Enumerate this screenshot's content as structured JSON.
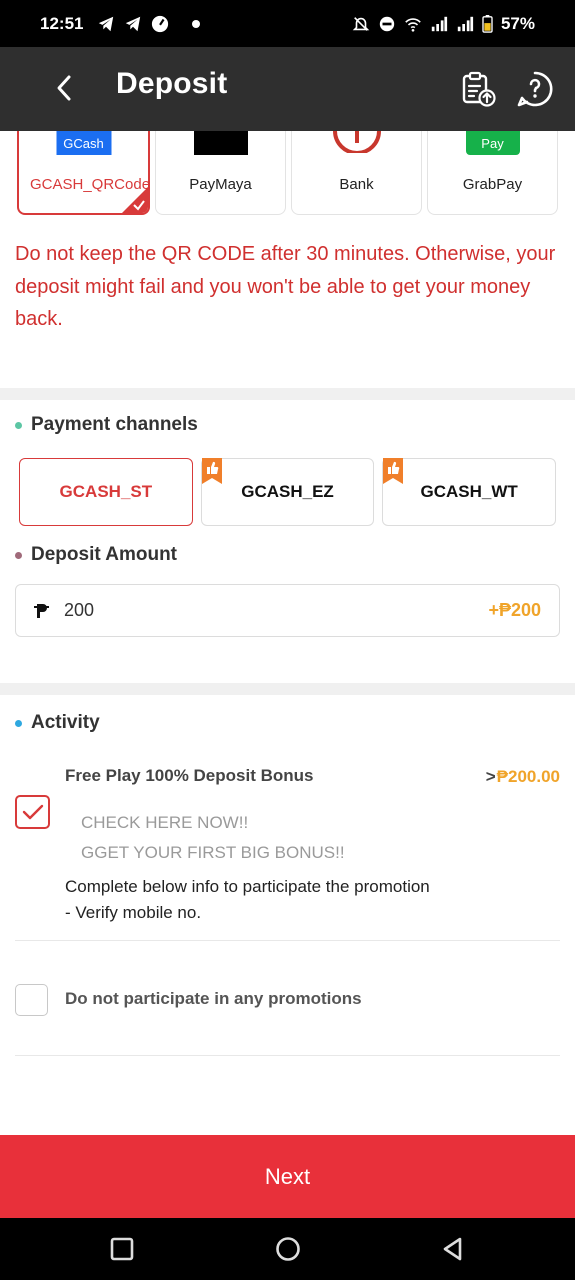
{
  "status_bar": {
    "time": "12:51",
    "battery": "57%"
  },
  "header": {
    "title": "Deposit"
  },
  "methods": [
    {
      "label": "GCASH_QRCode",
      "logo_text": "GCash",
      "selected": true
    },
    {
      "label": "PayMaya",
      "selected": false
    },
    {
      "label": "Bank",
      "selected": false
    },
    {
      "label": "GrabPay",
      "logo_text": "Pay",
      "selected": false
    }
  ],
  "warning": "Do not keep the QR CODE after 30 minutes. Otherwise, your deposit might fail and you won't be able to get your money back.",
  "payment_channels": {
    "title": "Payment channels",
    "items": [
      {
        "label": "GCASH_ST",
        "selected": true
      },
      {
        "label": "GCASH_EZ",
        "selected": false
      },
      {
        "label": "GCASH_WT",
        "selected": false
      }
    ]
  },
  "deposit_amount": {
    "title": "Deposit Amount",
    "value": "200",
    "bonus": "+₱200"
  },
  "activity": {
    "title": "Activity",
    "promo_title": "Free Play 100% Deposit Bonus",
    "promo_amount_prefix": ">",
    "promo_amount": "₱200.00",
    "promo_line1": "CHECK HERE NOW!!",
    "promo_line2": "GGET YOUR FIRST BIG BONUS!!",
    "info_line1": "Complete below info to participate the promotion",
    "info_line2": "- Verify mobile no.",
    "no_promo_label": "Do not participate in any promotions"
  },
  "next_button": "Next",
  "colors": {
    "accent": "#e8303a",
    "warning": "#d0302f",
    "bonus": "#f0a42a",
    "header": "#2f2f2f"
  }
}
